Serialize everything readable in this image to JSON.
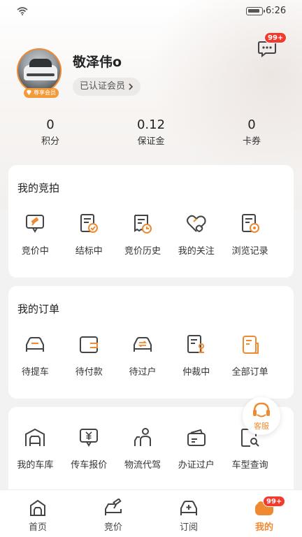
{
  "status_bar": {
    "time": "6:26"
  },
  "profile": {
    "username": "敬泽伟o",
    "verified_label": "已认证会员",
    "vip_label": "尊享会员",
    "message_badge": "99+"
  },
  "stats": [
    {
      "value": "0",
      "label": "积分"
    },
    {
      "value": "0.12",
      "label": "保证金"
    },
    {
      "value": "0",
      "label": "卡券"
    }
  ],
  "my_auction": {
    "title": "我的竞拍",
    "items": [
      {
        "label": "竞价中",
        "icon": "auction-hammer-icon"
      },
      {
        "label": "结标中",
        "icon": "document-check-icon"
      },
      {
        "label": "竞价历史",
        "icon": "document-clock-icon"
      },
      {
        "label": "我的关注",
        "icon": "heart-tag-icon"
      },
      {
        "label": "浏览记录",
        "icon": "document-eye-icon"
      }
    ]
  },
  "my_orders": {
    "title": "我的订单",
    "items": [
      {
        "label": "待提车",
        "icon": "car-icon"
      },
      {
        "label": "待付款",
        "icon": "wallet-icon"
      },
      {
        "label": "待过户",
        "icon": "car-transfer-icon"
      },
      {
        "label": "仲裁中",
        "icon": "arbitration-icon"
      },
      {
        "label": "全部订单",
        "icon": "all-orders-icon"
      }
    ]
  },
  "services": {
    "items": [
      {
        "label": "我的车库",
        "icon": "garage-icon"
      },
      {
        "label": "传车报价",
        "icon": "price-quote-icon"
      },
      {
        "label": "物流代驾",
        "icon": "driver-icon"
      },
      {
        "label": "办证过户",
        "icon": "certificate-card-icon"
      },
      {
        "label": "车型查询",
        "icon": "model-search-icon"
      }
    ]
  },
  "floating_service": {
    "label": "客服"
  },
  "tabs": [
    {
      "label": "首页",
      "icon": "home-icon",
      "active": false
    },
    {
      "label": "竞价",
      "icon": "bid-icon",
      "active": false
    },
    {
      "label": "订阅",
      "icon": "subscribe-icon",
      "active": false
    },
    {
      "label": "我的",
      "icon": "mine-icon",
      "active": true,
      "badge": "99+"
    }
  ],
  "colors": {
    "accent": "#ef8a33",
    "badge_red": "#f23a2e"
  }
}
